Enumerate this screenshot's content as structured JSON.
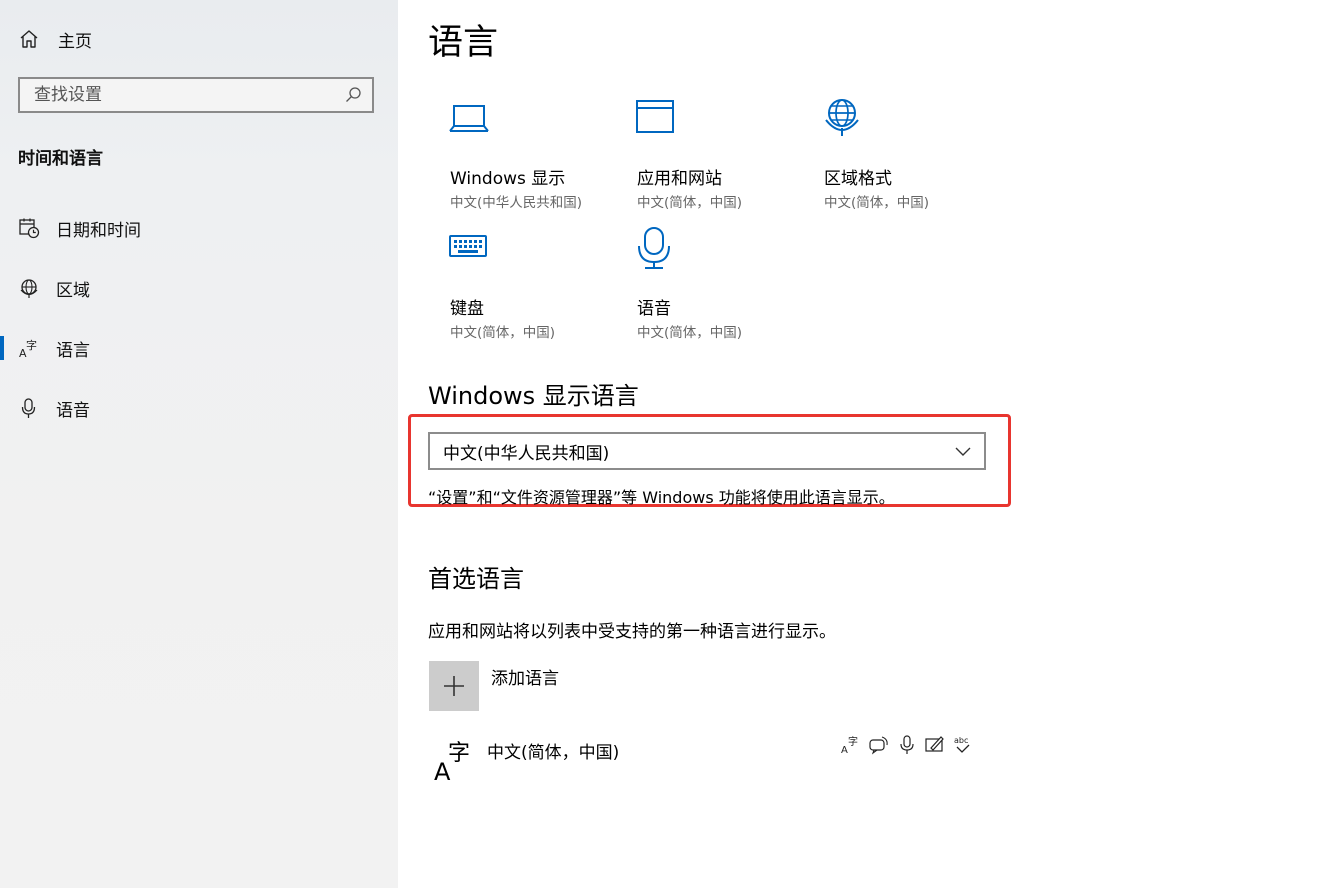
{
  "sidebar": {
    "home_label": "主页",
    "search_placeholder": "查找设置",
    "section_title": "时间和语言",
    "items": [
      {
        "label": "日期和时间",
        "icon": "calendar-clock-icon"
      },
      {
        "label": "区域",
        "icon": "globe-icon"
      },
      {
        "label": "语言",
        "icon": "language-icon",
        "active": true
      },
      {
        "label": "语音",
        "icon": "microphone-icon"
      }
    ]
  },
  "main": {
    "title": "语言",
    "tiles": [
      {
        "title": "Windows 显示",
        "subtitle": "中文(中华人民共和国)",
        "icon": "laptop-icon"
      },
      {
        "title": "应用和网站",
        "subtitle": "中文(简体，中国)",
        "icon": "window-icon"
      },
      {
        "title": "区域格式",
        "subtitle": "中文(简体，中国)",
        "icon": "region-globe-icon"
      },
      {
        "title": "键盘",
        "subtitle": "中文(简体，中国)",
        "icon": "keyboard-icon"
      },
      {
        "title": "语音",
        "subtitle": "中文(简体，中国)",
        "icon": "microphone-icon"
      }
    ],
    "display_language": {
      "heading": "Windows 显示语言",
      "selected": "中文(中华人民共和国)",
      "note": "“设置”和“文件资源管理器”等 Windows 功能将使用此语言显示。"
    },
    "preferred": {
      "heading": "首选语言",
      "description": "应用和网站将以列表中受支持的第一种语言进行显示。",
      "add_label": "添加语言",
      "languages": [
        {
          "name": "中文(简体，中国)",
          "features": [
            "display-language-icon",
            "text-to-speech-icon",
            "speech-recognition-icon",
            "handwriting-icon",
            "spellcheck-icon"
          ]
        }
      ]
    }
  },
  "colors": {
    "accent": "#0067c0",
    "highlight_border": "#e8352f",
    "add_button_bg": "#cccccc"
  }
}
